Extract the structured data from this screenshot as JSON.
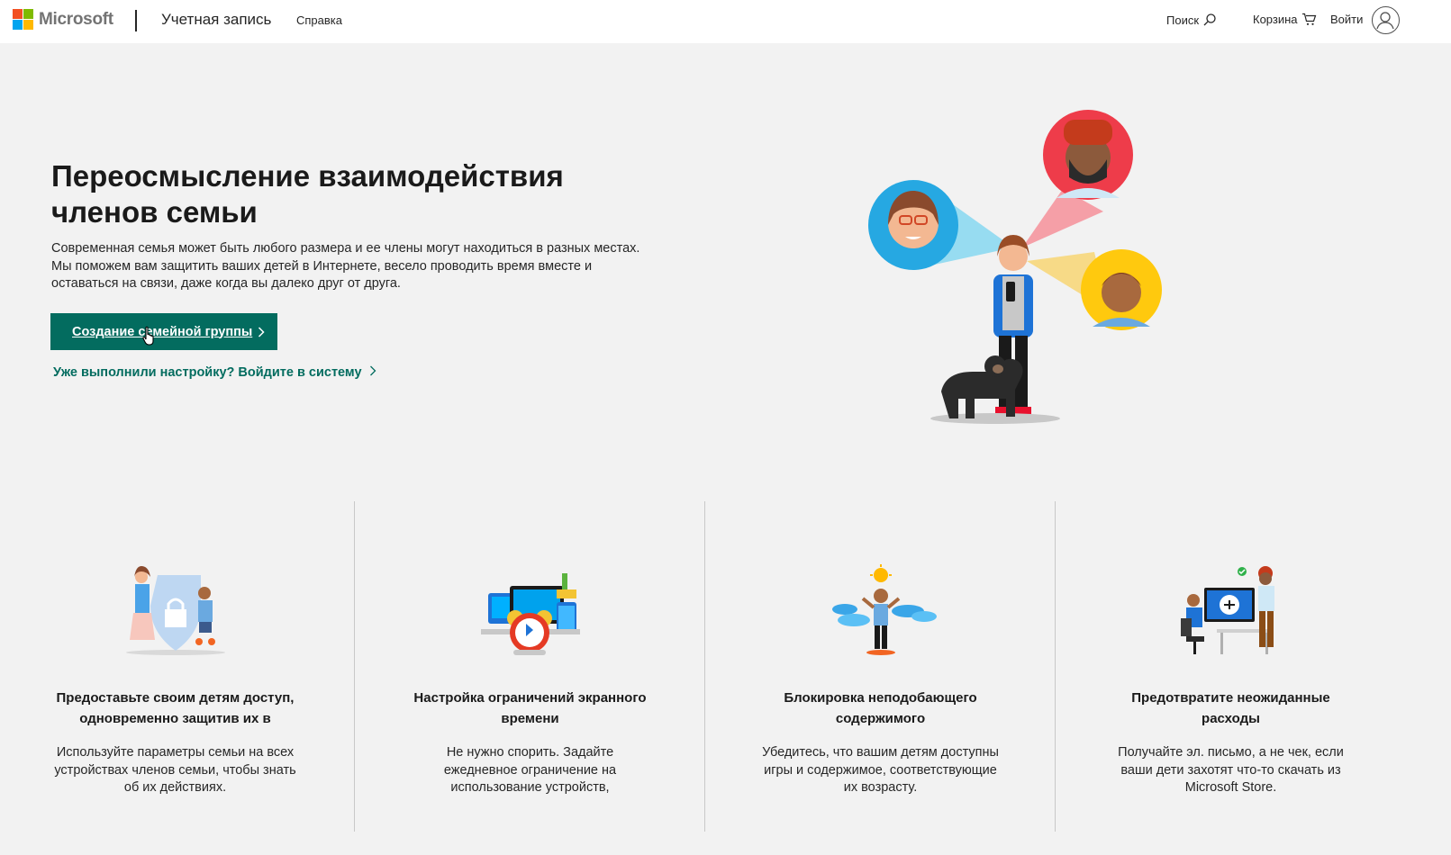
{
  "header": {
    "brand": "Microsoft",
    "title": "Учетная запись",
    "help": "Справка",
    "search": "Поиск",
    "cart": "Корзина",
    "signin": "Войти"
  },
  "hero": {
    "title": "Переосмысление взаимодействия членов семьи",
    "description": "Современная семья может быть любого размера и ее члены могут находиться в разных местах. Мы поможем вам защитить ваших детей в Интернете, весело проводить время вместе и оставаться на связи, даже когда вы далеко друг от друга.",
    "cta_label": "Создание семейной группы",
    "signin_link": "Уже выполнили настройку? Войдите в систему"
  },
  "features": [
    {
      "title": "Предоставьте своим детям доступ, одновременно защитив их в",
      "text": "Используйте параметры семьи на всех устройствах членов семьи, чтобы знать об их действиях."
    },
    {
      "title": "Настройка ограничений экранного времени",
      "text": "Не нужно спорить. Задайте ежедневное ограничение на использование устройств,"
    },
    {
      "title": "Блокировка неподобающего содержимого",
      "text": "Убедитесь, что вашим детям доступны игры и содержимое, соответствующие их возрасту."
    },
    {
      "title": "Предотвратите неожиданные расходы",
      "text": "Получайте эл. письмо, а не чек, если ваши дети захотят что-то скачать из Microsoft Store."
    }
  ],
  "colors": {
    "accent": "#036c5f",
    "background": "#f2f2f2"
  }
}
